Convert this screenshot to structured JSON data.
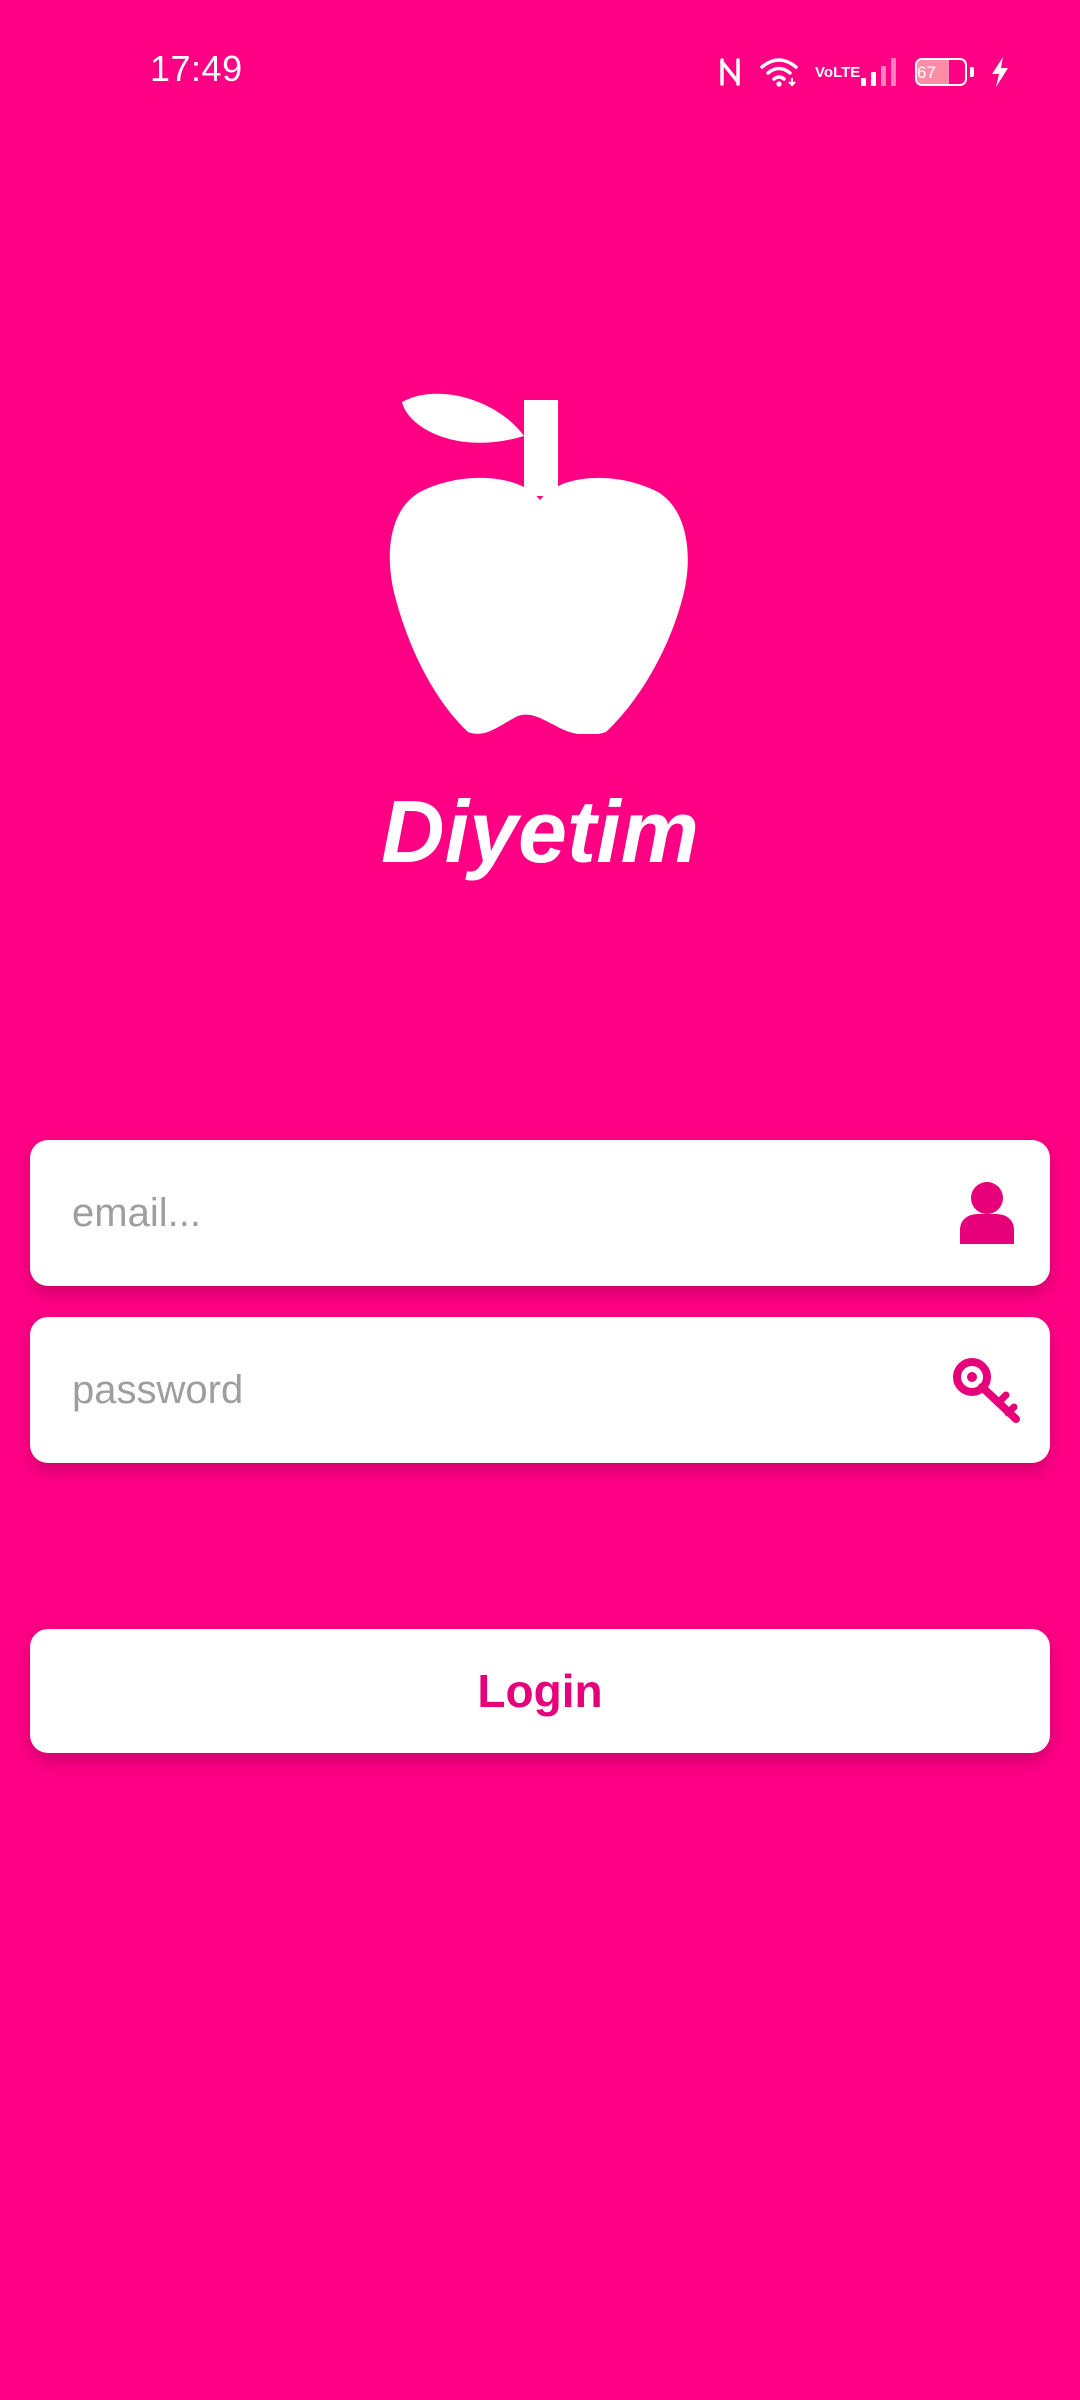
{
  "status_bar": {
    "time": "17:49",
    "battery_percent": 67,
    "battery_label": "67",
    "volte_top": "Vo",
    "volte_bottom": "LTE",
    "icons": [
      "nfc-icon",
      "wifi-icon",
      "volte-icon",
      "signal-icon",
      "battery-icon",
      "charging-icon"
    ]
  },
  "app": {
    "title": "Diyetim",
    "logo_icon": "apple-icon"
  },
  "form": {
    "email_placeholder": "email...",
    "email_value": "",
    "email_icon": "user-icon",
    "password_placeholder": "password",
    "password_value": "",
    "password_icon": "key-icon",
    "login_label": "Login"
  },
  "colors": {
    "background": "#FF0085",
    "accent": "#E6007A",
    "card": "#FFFFFF",
    "placeholder": "#9E9E9E"
  }
}
